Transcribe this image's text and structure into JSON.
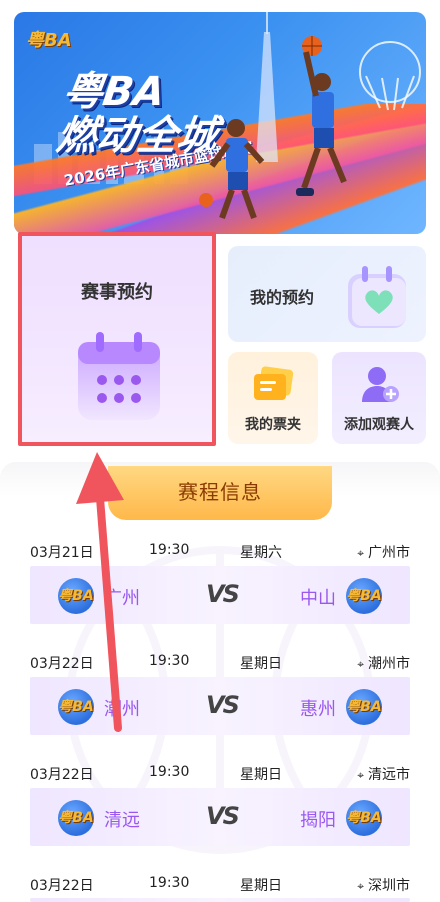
{
  "banner": {
    "logo_small": "粤BA",
    "title_line1": "粤BA",
    "title_line2": "燃动全城",
    "subtitle": "2026年广东省城市篮球联赛"
  },
  "cards": {
    "book_event": "赛事预约",
    "my_reservations": "我的预约",
    "ticket_wallet": "我的票夹",
    "add_viewer": "添加观赛人"
  },
  "schedule": {
    "title": "赛程信息",
    "vs_label": "VS",
    "team_logo_text": "粤BA",
    "matches": [
      {
        "date": "03月21日",
        "time": "19:30",
        "weekday": "星期六",
        "city": "广州市",
        "home": "广州",
        "away": "中山"
      },
      {
        "date": "03月22日",
        "time": "19:30",
        "weekday": "星期日",
        "city": "潮州市",
        "home": "潮州",
        "away": "惠州"
      },
      {
        "date": "03月22日",
        "time": "19:30",
        "weekday": "星期日",
        "city": "清远市",
        "home": "清远",
        "away": "揭阳"
      },
      {
        "date": "03月22日",
        "time": "19:30",
        "weekday": "星期日",
        "city": "深圳市"
      }
    ]
  },
  "colors": {
    "highlight_border": "#f0545c",
    "arrow": "#f0545c",
    "team_name": "#9a58ee",
    "tab_gradient_top": "#ffd882",
    "tab_gradient_bottom": "#ffb84a"
  }
}
